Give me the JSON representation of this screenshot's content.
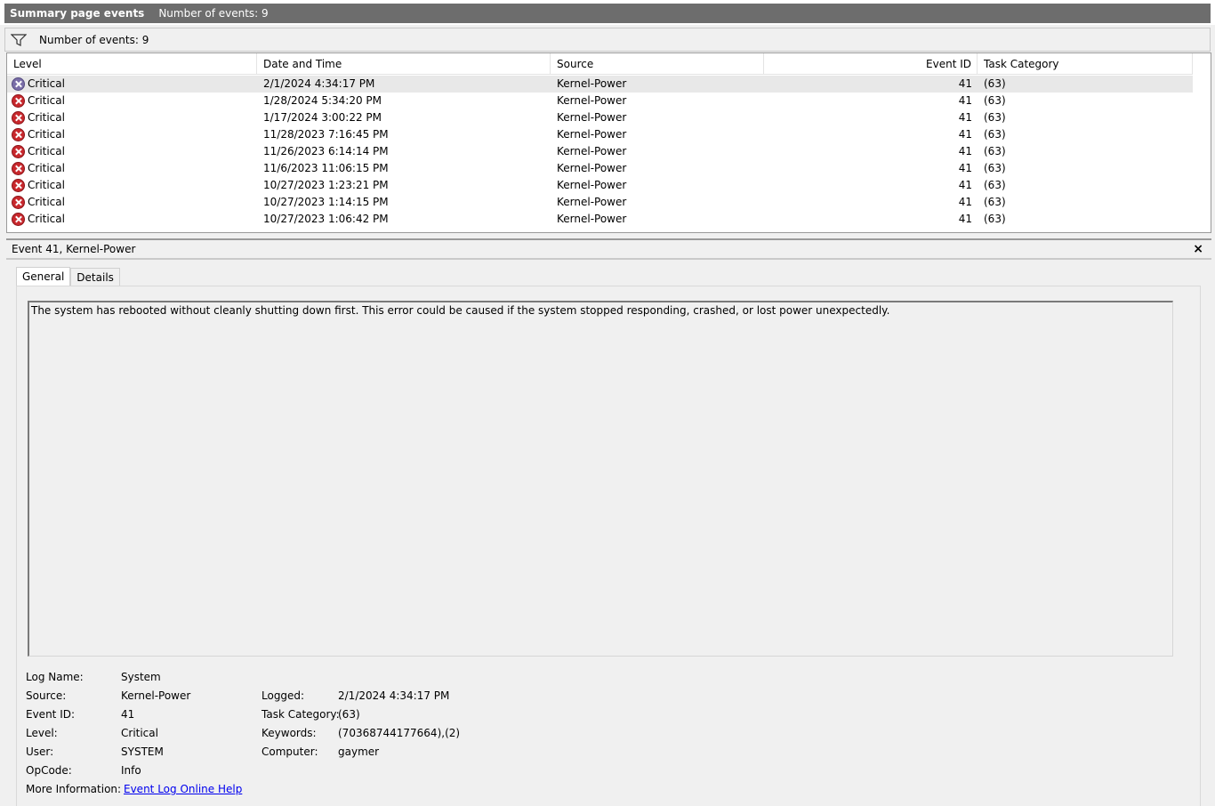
{
  "titlebar": {
    "title": "Summary page events",
    "count": "Number of events: 9"
  },
  "filter": {
    "count": "Number of events: 9"
  },
  "table": {
    "columns": [
      "Level",
      "Date and Time",
      "Source",
      "Event ID",
      "Task Category"
    ],
    "rows": [
      {
        "level": "Critical",
        "date": "2/1/2024 4:34:17 PM",
        "source": "Kernel-Power",
        "id": "41",
        "task": "(63)"
      },
      {
        "level": "Critical",
        "date": "1/28/2024 5:34:20 PM",
        "source": "Kernel-Power",
        "id": "41",
        "task": "(63)"
      },
      {
        "level": "Critical",
        "date": "1/17/2024 3:00:22 PM",
        "source": "Kernel-Power",
        "id": "41",
        "task": "(63)"
      },
      {
        "level": "Critical",
        "date": "11/28/2023 7:16:45 PM",
        "source": "Kernel-Power",
        "id": "41",
        "task": "(63)"
      },
      {
        "level": "Critical",
        "date": "11/26/2023 6:14:14 PM",
        "source": "Kernel-Power",
        "id": "41",
        "task": "(63)"
      },
      {
        "level": "Critical",
        "date": "11/6/2023 11:06:15 PM",
        "source": "Kernel-Power",
        "id": "41",
        "task": "(63)"
      },
      {
        "level": "Critical",
        "date": "10/27/2023 1:23:21 PM",
        "source": "Kernel-Power",
        "id": "41",
        "task": "(63)"
      },
      {
        "level": "Critical",
        "date": "10/27/2023 1:14:15 PM",
        "source": "Kernel-Power",
        "id": "41",
        "task": "(63)"
      },
      {
        "level": "Critical",
        "date": "10/27/2023 1:06:42 PM",
        "source": "Kernel-Power",
        "id": "41",
        "task": "(63)"
      }
    ]
  },
  "detail": {
    "title": "Event 41, Kernel-Power",
    "close": "×",
    "tabs": [
      "General",
      "Details"
    ],
    "description": "The system has rebooted without cleanly shutting down first. This error could be caused if the system stopped responding, crashed, or lost power unexpectedly.",
    "fields": {
      "log_name_label": "Log Name:",
      "log_name": "System",
      "source_label": "Source:",
      "source": "Kernel-Power",
      "logged_label": "Logged:",
      "logged": "2/1/2024 4:34:17 PM",
      "event_id_label": "Event ID:",
      "event_id": "41",
      "task_label": "Task Category:",
      "task": "(63)",
      "level_label": "Level:",
      "level": "Critical",
      "keywords_label": "Keywords:",
      "keywords": "(70368744177664),(2)",
      "user_label": "User:",
      "user": "SYSTEM",
      "computer_label": "Computer:",
      "computer": "gaymer",
      "opcode_label": "OpCode:",
      "opcode": "Info",
      "more_label": "More Information:",
      "more_link": "Event Log Online Help"
    }
  },
  "colors": {
    "titlebar_bg": "#6d6d6d",
    "critical_red": "#c8282d",
    "selected_icon": "#7a6ea8",
    "link": "#0000ee"
  },
  "icons": [
    "filter-icon",
    "critical-icon",
    "close-icon"
  ]
}
